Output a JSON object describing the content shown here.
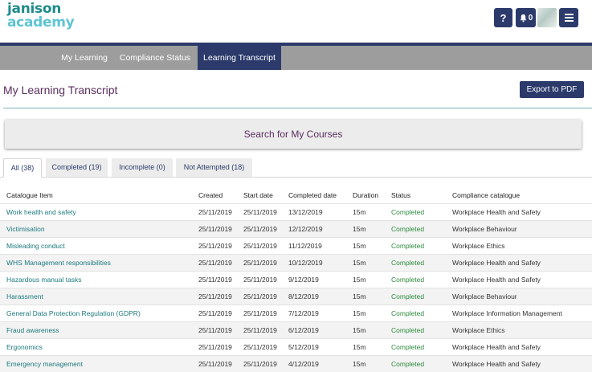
{
  "header": {
    "logo_line1": "janison",
    "logo_line2": "academy",
    "help_label": "?",
    "notification_count": "0",
    "icons": [
      "help-icon",
      "bell-icon",
      "avatar",
      "menu-icon"
    ]
  },
  "nav": {
    "items": [
      {
        "label": "My Learning"
      },
      {
        "label": "Compliance Status"
      },
      {
        "label": "Learning Transcript"
      }
    ],
    "active": "Learning Transcript"
  },
  "page": {
    "title": "My Learning Transcript",
    "export_label": "Export to PDF"
  },
  "search": {
    "label": "Search for My Courses"
  },
  "tabs": [
    {
      "label": "All (38)"
    },
    {
      "label": "Completed (19)"
    },
    {
      "label": "Incomplete (0)"
    },
    {
      "label": "Not Attempted (18)"
    }
  ],
  "table": {
    "columns": [
      "Catalogue Item",
      "Created",
      "Start date",
      "Completed date",
      "Duration",
      "Status",
      "Compliance catalogue"
    ],
    "rows": [
      {
        "item": "Work health and safety",
        "created": "25/11/2019",
        "start": "25/11/2019",
        "completed": "13/12/2019",
        "duration": "15m",
        "status": "Completed",
        "catalogue": "Workplace Health and Safety"
      },
      {
        "item": "Victimisation",
        "created": "25/11/2019",
        "start": "25/11/2019",
        "completed": "12/12/2019",
        "duration": "15m",
        "status": "Completed",
        "catalogue": "Workplace Behaviour"
      },
      {
        "item": "Misleading conduct",
        "created": "25/11/2019",
        "start": "25/11/2019",
        "completed": "11/12/2019",
        "duration": "15m",
        "status": "Completed",
        "catalogue": "Workplace Ethics"
      },
      {
        "item": "WHS Management responsibilities",
        "created": "25/11/2019",
        "start": "25/11/2019",
        "completed": "10/12/2019",
        "duration": "15m",
        "status": "Completed",
        "catalogue": "Workplace Health and Safety"
      },
      {
        "item": "Hazardous manual tasks",
        "created": "25/11/2019",
        "start": "25/11/2019",
        "completed": "9/12/2019",
        "duration": "15m",
        "status": "Completed",
        "catalogue": "Workplace Health and Safety"
      },
      {
        "item": "Harassment",
        "created": "25/11/2019",
        "start": "25/11/2019",
        "completed": "8/12/2019",
        "duration": "15m",
        "status": "Completed",
        "catalogue": "Workplace Behaviour"
      },
      {
        "item": "General Data Protection Regulation (GDPR)",
        "created": "25/11/2019",
        "start": "25/11/2019",
        "completed": "7/12/2019",
        "duration": "15m",
        "status": "Completed",
        "catalogue": "Workplace Information Management"
      },
      {
        "item": "Fraud awareness",
        "created": "25/11/2019",
        "start": "25/11/2019",
        "completed": "6/12/2019",
        "duration": "15m",
        "status": "Completed",
        "catalogue": "Workplace Ethics"
      },
      {
        "item": "Ergonomics",
        "created": "25/11/2019",
        "start": "25/11/2019",
        "completed": "5/12/2019",
        "duration": "15m",
        "status": "Completed",
        "catalogue": "Workplace Health and Safety"
      },
      {
        "item": "Emergency management",
        "created": "25/11/2019",
        "start": "25/11/2019",
        "completed": "4/12/2019",
        "duration": "15m",
        "status": "Completed",
        "catalogue": "Workplace Health and Safety"
      }
    ]
  },
  "colors": {
    "brand_navy": "#2b3a6b",
    "nav_gray": "#9d9d9d",
    "title_purple": "#5a2d5e",
    "link_teal": "#1c7a7e",
    "status_green": "#2d8a3e",
    "logo_teal": "#1f8a8a",
    "logo_light": "#5fc4d4"
  }
}
